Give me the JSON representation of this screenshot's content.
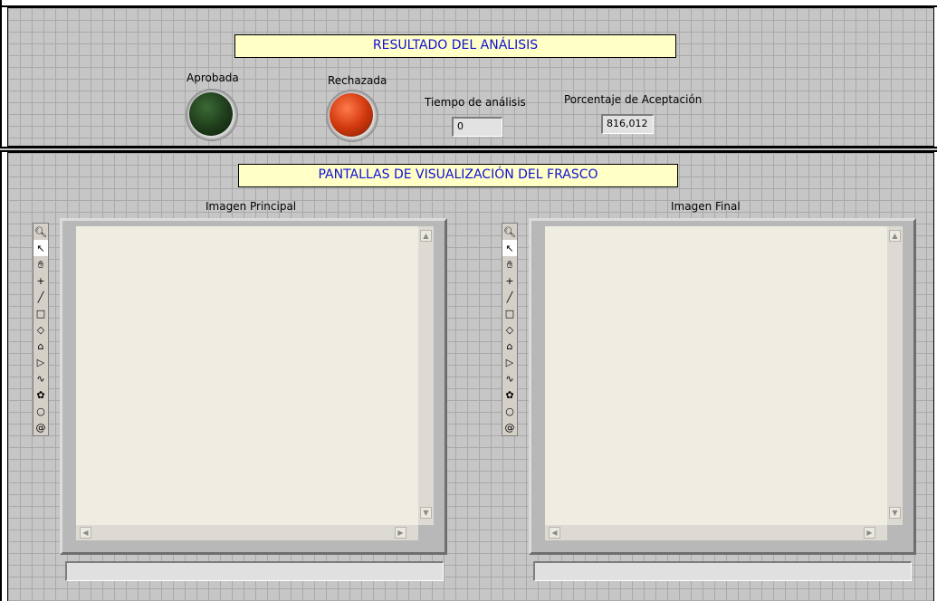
{
  "results": {
    "title": "RESULTADO DEL ANÁLISIS",
    "approved_label": "Aprobada",
    "rejected_label": "Rechazada",
    "approved_led_color": "#1e3b1a",
    "rejected_led_color": "#d23a0f",
    "time_label": "Tiempo de análisis",
    "time_value": "0",
    "acceptance_label": "Porcentaje de Aceptación",
    "acceptance_value": "816,012"
  },
  "screens": {
    "title": "PANTALLAS DE VISUALIZACIÓN DEL FRASCO",
    "main_image_label": "Imagen Principal",
    "final_image_label": "Imagen Final",
    "tools": [
      "zoom-icon",
      "pointer-icon",
      "pan-hand-icon",
      "crosshair-point-icon",
      "line-icon",
      "rectangle-icon",
      "rotated-rectangle-icon",
      "annulus-icon",
      "polygon-icon",
      "freehand-line-icon",
      "freehand-region-icon",
      "oval-icon",
      "spiral-icon"
    ]
  },
  "colors": {
    "background": "#c6c6c6",
    "title_bg": "#ffffc6",
    "title_text": "#1010d8",
    "image_bg": "#efece1"
  }
}
